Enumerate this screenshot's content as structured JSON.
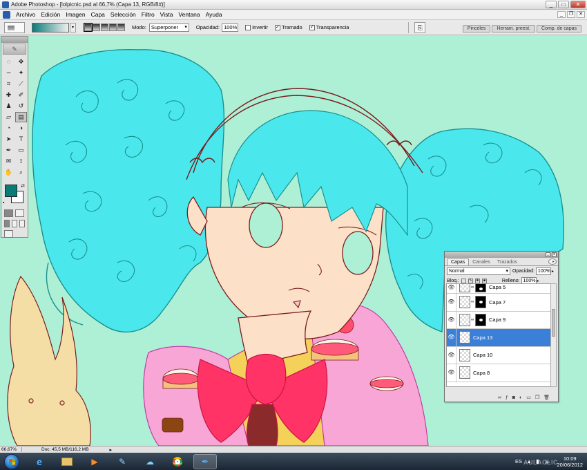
{
  "window": {
    "title": "Adobe Photoshop - [lolpicnic.psd al 66,7% (Capa 13, RGB/8#)]",
    "controls": {
      "minimize": "_",
      "maximize": "□",
      "close": "✕"
    }
  },
  "menu": {
    "items": [
      "Archivo",
      "Edición",
      "Imagen",
      "Capa",
      "Selección",
      "Filtro",
      "Vista",
      "Ventana",
      "Ayuda"
    ],
    "doc_controls": {
      "minimize": "_",
      "restore": "❐",
      "close": "✕"
    }
  },
  "options": {
    "mode_label": "Modo:",
    "mode_value": "Superponer",
    "opacity_label": "Opacidad:",
    "opacity_value": "100%",
    "invert_label": "Invertir",
    "invert_checked": false,
    "dither_label": "Tramado",
    "dither_checked": true,
    "transparency_label": "Transparencia",
    "transparency_checked": true,
    "well_tabs": [
      "Pinceles",
      "Herram. preest.",
      "Comp. de capas"
    ],
    "gradient_colors": [
      "#0a7c78",
      "#f0f0f0"
    ]
  },
  "toolbox": {
    "foreground_color": "#0a7c78",
    "background_color": "#ffffff"
  },
  "layers_panel": {
    "tabs": [
      "Capas",
      "Canales",
      "Trazados"
    ],
    "active_tab": "Capas",
    "blend_mode": "Normal",
    "opacity_label": "Opacidad:",
    "opacity_value": "100%",
    "lock_label": "Bloq.:",
    "fill_label": "Relleno:",
    "fill_value": "100%",
    "layers": [
      {
        "name": "Capa 5",
        "has_mask": true,
        "active": false
      },
      {
        "name": "Capa 7",
        "has_mask": true,
        "active": false
      },
      {
        "name": "Capa 9",
        "has_mask": true,
        "active": false
      },
      {
        "name": "Capa 13",
        "has_mask": false,
        "active": true
      },
      {
        "name": "Capa 10",
        "has_mask": false,
        "active": false
      },
      {
        "name": "Capa 8",
        "has_mask": false,
        "active": false
      }
    ]
  },
  "status": {
    "zoom": "66,67%",
    "doc_info": "Doc: 45,5 MB/116,2 MB"
  },
  "taskbar": {
    "language": "ES",
    "time": "10:09",
    "date": "20/06/2012"
  },
  "colors": {
    "canvas_bg": "#aef0d6",
    "hair": "#4ae8ec",
    "hair_line": "#1a8f8f",
    "skin": "#fde0c8",
    "line_art": "#7a1c1c",
    "bow": "#ff3366",
    "dress": "#f7a6d6",
    "bunny": "#f5dea6",
    "selection_blue": "#3a7fd8"
  }
}
